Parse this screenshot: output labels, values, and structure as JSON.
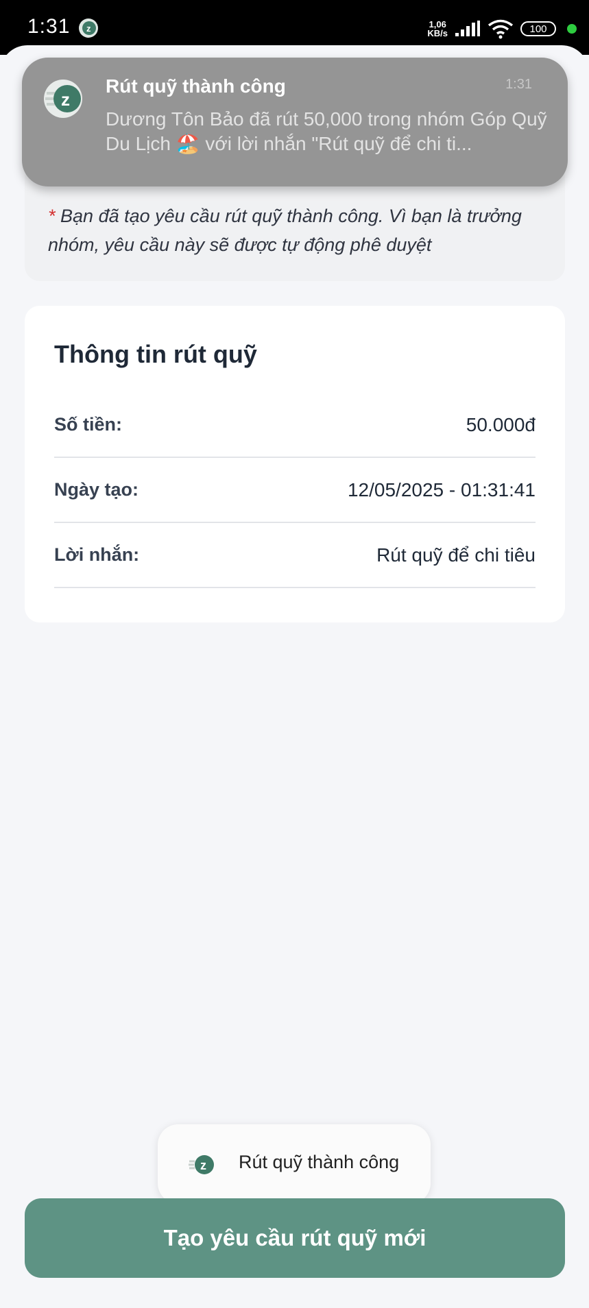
{
  "status_bar": {
    "time": "1:31",
    "net_speed_value": "1,06",
    "net_speed_unit": "KB/s",
    "battery": "100"
  },
  "notification": {
    "title": "Rút quỹ thành công",
    "time": "1:31",
    "body": "Dương Tôn Bảo đã rút 50,000 trong nhóm Góp Quỹ Du Lịch 🏖️ với lời nhắn \"Rút quỹ để chi ti..."
  },
  "info_card": {
    "asterisk": "*",
    "note": "Bạn đã tạo yêu cầu rút quỹ thành công. Vì bạn là trưởng nhóm, yêu cầu này sẽ được tự động phê duyệt"
  },
  "details": {
    "title": "Thông tin rút quỹ",
    "rows": [
      {
        "label": "Số tiền:",
        "value": "50.000đ"
      },
      {
        "label": "Ngày tạo:",
        "value": "12/05/2025 - 01:31:41"
      },
      {
        "label": "Lời nhắn:",
        "value": "Rút quỹ để chi tiêu"
      }
    ]
  },
  "toast": {
    "text": "Rút quỹ thành công"
  },
  "primary_button": {
    "label": "Tạo yêu cầu rút quỹ mới"
  },
  "colors": {
    "accent": "#5e9384",
    "asterisk": "#d32f2f",
    "notification_bg": "#959595"
  },
  "icons": [
    "app-logo-icon",
    "signal-icon",
    "wifi-icon",
    "battery-icon"
  ]
}
